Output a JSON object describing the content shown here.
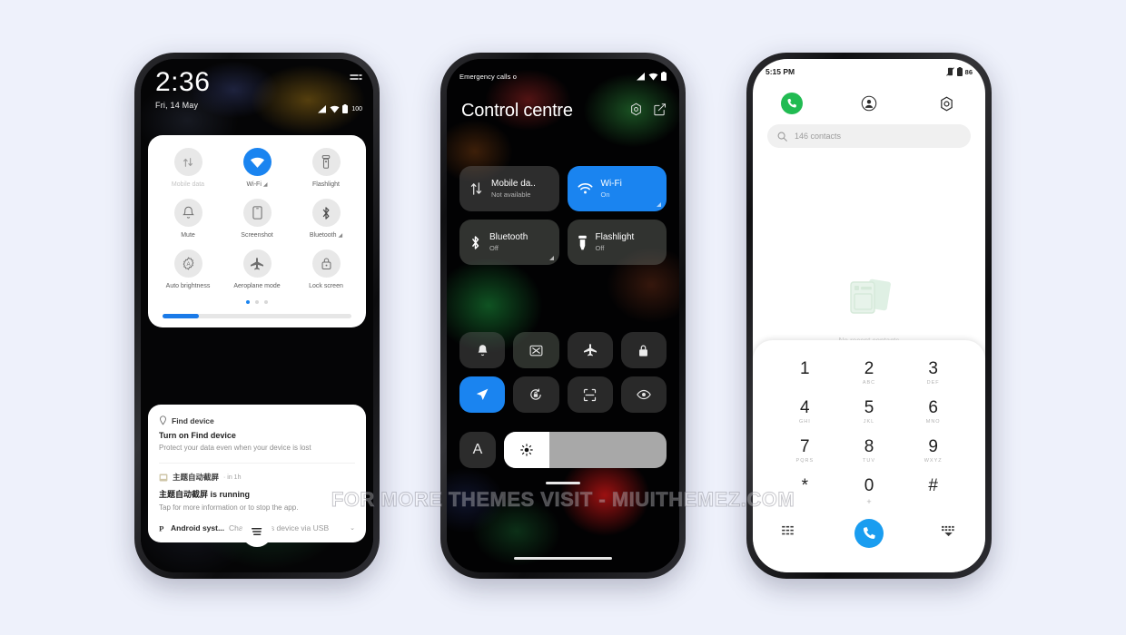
{
  "watermark": "FOR MORE THEMES VISIT - MIUITHEMEZ.COM",
  "background_color": "#eef1fb",
  "phone1": {
    "name": "lockscreen-quick-settings",
    "status": {
      "clock": "2:36",
      "date": "Fri, 14 May",
      "battery": "100"
    },
    "quick_settings": {
      "tiles": [
        {
          "label": "Mobile data",
          "icon": "data-transfer-icon",
          "state": "unavailable"
        },
        {
          "label": "Wi-Fi",
          "icon": "wifi-icon",
          "state": "on",
          "corner": "◢"
        },
        {
          "label": "Flashlight",
          "icon": "flashlight-icon",
          "state": "off"
        },
        {
          "label": "Mute",
          "icon": "bell-icon",
          "state": "off"
        },
        {
          "label": "Screenshot",
          "icon": "phone-screenshot-icon",
          "state": "off"
        },
        {
          "label": "Bluetooth",
          "icon": "bluetooth-icon",
          "state": "off",
          "corner": "◢"
        },
        {
          "label": "Auto brightness",
          "icon": "auto-brightness-icon",
          "state": "off"
        },
        {
          "label": "Aeroplane mode",
          "icon": "airplane-icon",
          "state": "off"
        },
        {
          "label": "Lock screen",
          "icon": "lock-icon",
          "state": "off"
        }
      ],
      "page_dots": 3,
      "active_dot": 0,
      "brightness_percent": 19,
      "accent_color": "#1a84f0"
    },
    "notifications": [
      {
        "app": "Find device",
        "app_icon": "location-pin-icon",
        "title": "Turn on Find device",
        "body": "Protect your data even when your device is lost"
      },
      {
        "app": "主题自动截屏",
        "app_icon": "app-window-icon",
        "meta": "· in 1h",
        "title": "主题自动截屏 is running",
        "body": "Tap for more information or to stop the app."
      },
      {
        "app": "Android syst...",
        "app_icon": "android-p-icon",
        "text": "Charging this device via USB",
        "chevron": "⌄"
      }
    ],
    "fab_icon": "notification-list-icon"
  },
  "phone2": {
    "name": "control-centre",
    "status": {
      "emergency": "Emergency calls o"
    },
    "title": "Control centre",
    "header_icons": [
      {
        "name": "settings-gear-icon"
      },
      {
        "name": "edit-pencil-icon"
      }
    ],
    "big_tiles": [
      {
        "title": "Mobile da..",
        "subtitle": "Not available",
        "icon": "data-transfer-icon",
        "state": "off"
      },
      {
        "title": "Wi-Fi",
        "subtitle": "On",
        "icon": "wifi-icon",
        "state": "on",
        "corner": true
      },
      {
        "title": "Bluetooth",
        "subtitle": "Off",
        "icon": "bluetooth-icon",
        "state": "off",
        "corner": true
      },
      {
        "title": "Flashlight",
        "subtitle": "Off",
        "icon": "flashlight-icon",
        "state": "off"
      }
    ],
    "small_tiles": [
      {
        "icon": "bell-icon",
        "state": "off"
      },
      {
        "icon": "cast-screen-icon",
        "state": "off-green"
      },
      {
        "icon": "airplane-icon",
        "state": "off"
      },
      {
        "icon": "lock-icon",
        "state": "off"
      },
      {
        "icon": "location-arrow-icon",
        "state": "on"
      },
      {
        "icon": "rotation-lock-icon",
        "state": "off"
      },
      {
        "icon": "scan-frame-icon",
        "state": "off"
      },
      {
        "icon": "eye-icon",
        "state": "off"
      }
    ],
    "auto_brightness_label": "A",
    "brightness_percent": 28,
    "accent_color": "#1a84f0"
  },
  "phone3": {
    "name": "dialer-contacts",
    "status": {
      "time": "5:15 PM",
      "battery": "86"
    },
    "tabs": [
      {
        "name": "tab-phone",
        "icon": "phone-handset-icon",
        "active": true
      },
      {
        "name": "tab-contacts",
        "icon": "person-circle-icon",
        "active": false
      },
      {
        "name": "tab-settings",
        "icon": "settings-gear-icon",
        "active": false
      }
    ],
    "search": {
      "placeholder": "146 contacts",
      "icon": "search-icon"
    },
    "empty_state": {
      "label": "No recent contacts",
      "icon": "contact-cards-icon"
    },
    "keypad": [
      {
        "digit": "1",
        "sub": " "
      },
      {
        "digit": "2",
        "sub": "ABC"
      },
      {
        "digit": "3",
        "sub": "DEF"
      },
      {
        "digit": "4",
        "sub": "GHI"
      },
      {
        "digit": "5",
        "sub": "JKL"
      },
      {
        "digit": "6",
        "sub": "MNO"
      },
      {
        "digit": "7",
        "sub": "PQRS"
      },
      {
        "digit": "8",
        "sub": "TUV"
      },
      {
        "digit": "9",
        "sub": "WXYZ"
      },
      {
        "digit": "*",
        "sub": ""
      },
      {
        "digit": "0",
        "sub": "+"
      },
      {
        "digit": "#",
        "sub": ""
      }
    ],
    "bottom": {
      "left_icon": "call-log-icon",
      "call_icon": "phone-handset-icon",
      "right_icon": "hide-keypad-icon"
    },
    "accent_color": "#1a9df0",
    "call_green": "#21bb52"
  }
}
